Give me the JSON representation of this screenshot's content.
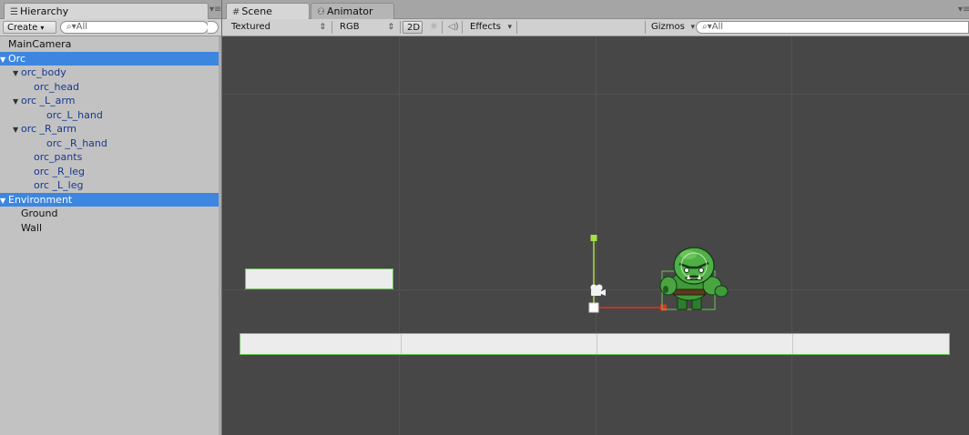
{
  "hierarchy": {
    "tab_label": "Hierarchy",
    "tab_icon": "list-icon",
    "create_label": "Create",
    "search_placeholder": "All",
    "items": [
      {
        "label": "MainCamera",
        "indent": 0,
        "expanded": null,
        "selected": false,
        "prefab": false
      },
      {
        "label": "Orc",
        "indent": 0,
        "expanded": true,
        "selected": true,
        "prefab": true
      },
      {
        "label": "orc_body",
        "indent": 1,
        "expanded": true,
        "selected": false,
        "prefab": true
      },
      {
        "label": "orc_head",
        "indent": 2,
        "expanded": null,
        "selected": false,
        "prefab": true
      },
      {
        "label": "orc _L_arm",
        "indent": 1,
        "expanded": true,
        "selected": false,
        "prefab": true
      },
      {
        "label": "orc_L_hand",
        "indent": 3,
        "expanded": null,
        "selected": false,
        "prefab": true
      },
      {
        "label": "orc _R_arm",
        "indent": 1,
        "expanded": true,
        "selected": false,
        "prefab": true
      },
      {
        "label": "orc _R_hand",
        "indent": 3,
        "expanded": null,
        "selected": false,
        "prefab": true
      },
      {
        "label": "orc_pants",
        "indent": 2,
        "expanded": null,
        "selected": false,
        "prefab": true
      },
      {
        "label": "orc _R_leg",
        "indent": 2,
        "expanded": null,
        "selected": false,
        "prefab": true
      },
      {
        "label": "orc _L_leg",
        "indent": 2,
        "expanded": null,
        "selected": false,
        "prefab": true
      },
      {
        "label": "Environment",
        "indent": 0,
        "expanded": true,
        "selected": true,
        "prefab": false
      },
      {
        "label": "Ground",
        "indent": 1,
        "expanded": null,
        "selected": false,
        "prefab": false
      },
      {
        "label": "Wall",
        "indent": 1,
        "expanded": null,
        "selected": false,
        "prefab": false
      }
    ]
  },
  "scene": {
    "tab_label": "Scene",
    "tab_icon": "hash-icon",
    "animator_tab_label": "Animator",
    "animator_tab_icon": "animator-icon",
    "shading_mode": "Textured",
    "render_mode": "RGB",
    "mode_2d_label": "2D",
    "effects_label": "Effects",
    "gizmos_label": "Gizmos",
    "search_placeholder": "All"
  },
  "colors": {
    "selection": "#3d86e0",
    "prefab_text": "#15388f",
    "scene_bg": "#474747",
    "outline_green": "#6ec35a",
    "axis_x": "#e0321e",
    "axis_y": "#a8e040"
  }
}
